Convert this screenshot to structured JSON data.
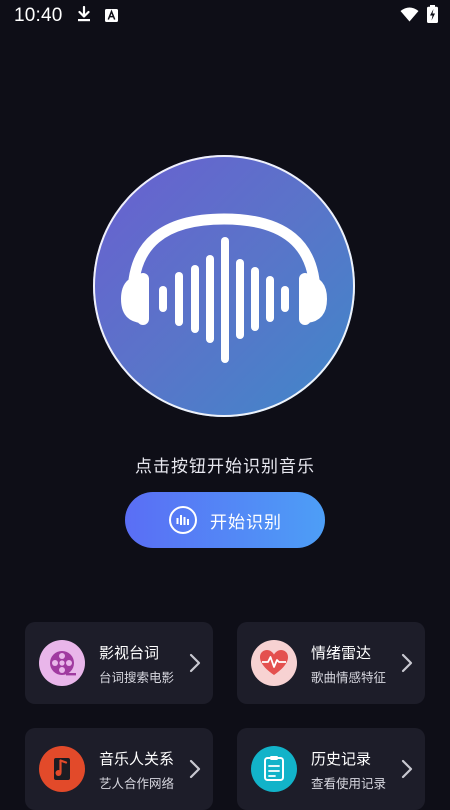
{
  "status_bar": {
    "time": "10:40",
    "icons": [
      "download-icon",
      "a-badge-icon",
      "wifi-icon",
      "battery-charging-icon"
    ]
  },
  "hero": {
    "icon": "headphones-waveform-icon",
    "gradient_colors": [
      "#6a5fd0",
      "#3f88c9"
    ]
  },
  "main": {
    "hint_text": "点击按钮开始识别音乐",
    "start_button": {
      "label": "开始识别",
      "icon": "audio-bars-icon",
      "gradient_colors": [
        "#5a6ef5",
        "#4d9ef6"
      ]
    }
  },
  "cards": [
    {
      "title": "影视台词",
      "subtitle": "台词搜索电影",
      "icon": "film-reel-icon",
      "icon_bg": "#e9b6ea"
    },
    {
      "title": "情绪雷达",
      "subtitle": "歌曲情感特征",
      "icon": "heart-pulse-icon",
      "icon_bg": "#f7d2d2"
    },
    {
      "title": "音乐人关系",
      "subtitle": "艺人合作网络",
      "icon": "music-note-icon",
      "icon_bg": "#e24a2a"
    },
    {
      "title": "历史记录",
      "subtitle": "查看使用记录",
      "icon": "clipboard-icon",
      "icon_bg": "#12b3c9"
    }
  ],
  "colors": {
    "background": "#0e0e17",
    "card_background": "#1d1d29"
  }
}
